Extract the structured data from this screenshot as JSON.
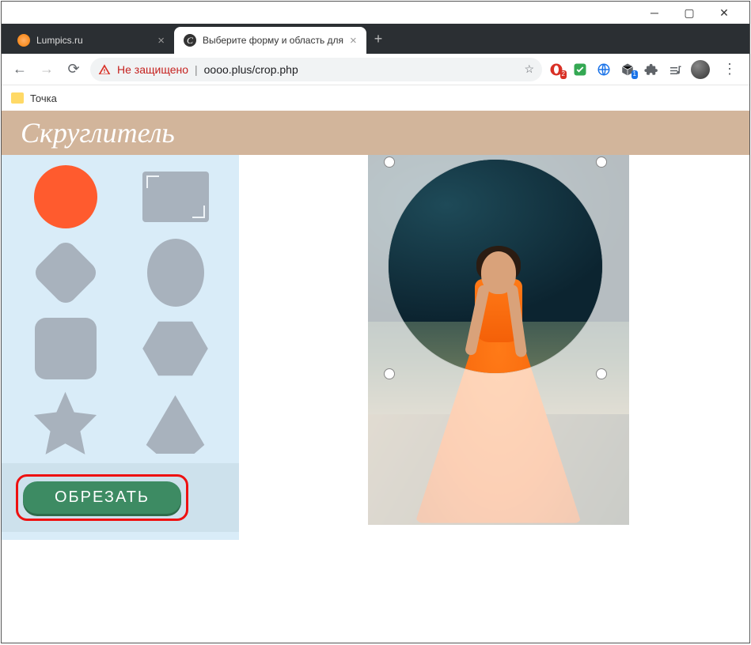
{
  "window": {
    "tabs": [
      {
        "title": "Lumpics.ru",
        "active": false
      },
      {
        "title": "Выберите форму и область для",
        "active": true
      }
    ],
    "new_tab_glyph": "+"
  },
  "toolbar": {
    "insecure_label": "Не защищено",
    "url": "oooo.plus/crop.php"
  },
  "bookmarks": [
    {
      "label": "Точка"
    }
  ],
  "page": {
    "brand": "Скруглитель",
    "shapes": [
      {
        "name": "circle",
        "selected": true
      },
      {
        "name": "rectangle",
        "selected": false
      },
      {
        "name": "diamond",
        "selected": false
      },
      {
        "name": "ellipse",
        "selected": false
      },
      {
        "name": "rounded-square",
        "selected": false
      },
      {
        "name": "hexagon",
        "selected": false
      },
      {
        "name": "star",
        "selected": false
      },
      {
        "name": "triangle",
        "selected": false
      }
    ],
    "crop_button": "ОБРЕЗАТЬ"
  },
  "extensions": {
    "badge1": "2",
    "badge2": "1"
  }
}
